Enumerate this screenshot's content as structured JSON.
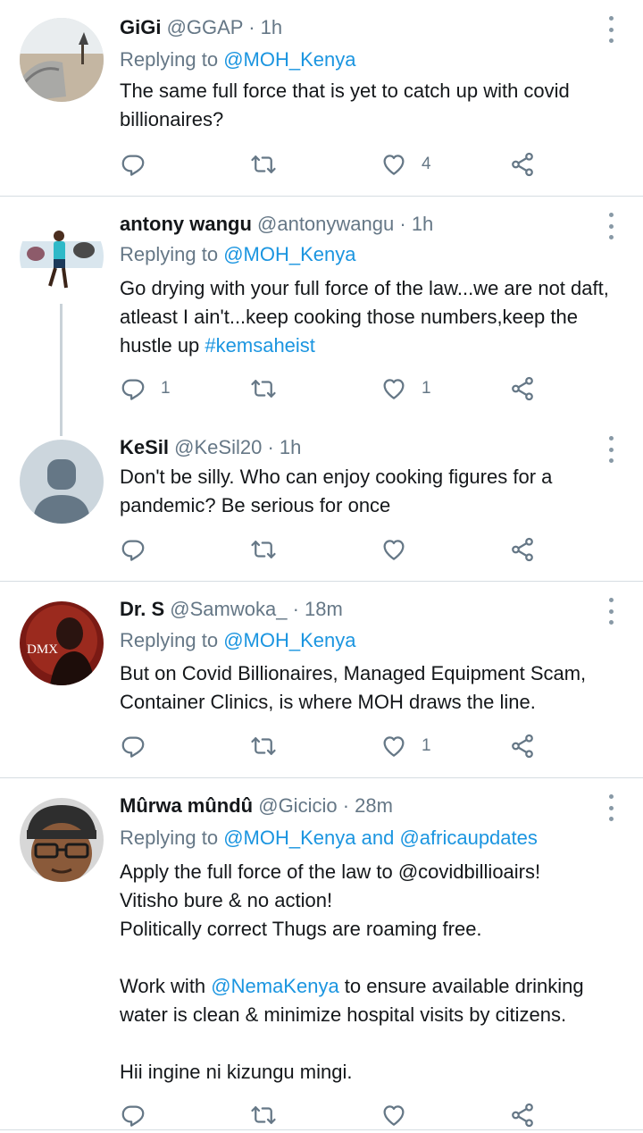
{
  "tweets": [
    {
      "name": "GiGi",
      "handle": "@GGAP",
      "sep": "·",
      "time": "1h",
      "replying_prefix": "Replying to",
      "replying_to": "@MOH_Kenya",
      "text": "The same full force that is yet to catch up with covid billionaires?",
      "reply_count": "",
      "retweet_count": "",
      "like_count": "4"
    },
    {
      "name": "antony wangu",
      "handle": "@antonywangu",
      "sep": "·",
      "time": "1h",
      "replying_prefix": "Replying to",
      "replying_to": "@MOH_Kenya",
      "text_before": "Go drying with your full force of the law...we are not daft, atleast I ain't...keep cooking those numbers,keep the hustle up ",
      "hashtag": "#kemsaheist",
      "reply_count": "1",
      "retweet_count": "",
      "like_count": "1"
    },
    {
      "name": "KeSil",
      "handle": "@KeSil20",
      "sep": "·",
      "time": "1h",
      "text": "Don't be silly. Who can enjoy cooking figures for a pandemic? Be serious for once",
      "reply_count": "",
      "retweet_count": "",
      "like_count": ""
    },
    {
      "name": "Dr. S",
      "handle": "@Samwoka_",
      "sep": "·",
      "time": "18m",
      "replying_prefix": "Replying to",
      "replying_to": "@MOH_Kenya",
      "text": "But on Covid Billionaires, Managed Equipment Scam, Container Clinics, is where MOH draws the line.",
      "avatar_text": "DMX",
      "reply_count": "",
      "retweet_count": "",
      "like_count": "1"
    },
    {
      "name": "Mûrwa mûndû",
      "handle": "@Gicicio",
      "sep": "·",
      "time": "28m",
      "replying_prefix": "Replying to",
      "replying_to": "@MOH_Kenya",
      "replying_and": "and",
      "replying_to_2": "@africaupdates",
      "line1": "Apply  the full force of the law to @covidbillioairs!",
      "line2": "Vitisho bure & no action!",
      "line3": "Politically correct Thugs are  roaming free.",
      "line4_before": "Work with ",
      "line4_mention": "@NemaKenya",
      "line4_after": " to ensure available drinking water is clean & minimize hospital visits by citizens.",
      "line5": "Hii ingine ni kizungu mingi.",
      "reply_count": "",
      "retweet_count": "",
      "like_count": ""
    }
  ],
  "icons": {
    "reply": "reply-icon",
    "retweet": "retweet-icon",
    "like": "heart-icon",
    "share": "share-icon",
    "more": "more-options-icon"
  },
  "colors": {
    "link": "#1b95e0",
    "secondary": "#657786",
    "icon": "#657786",
    "divider": "#d6dde2"
  }
}
